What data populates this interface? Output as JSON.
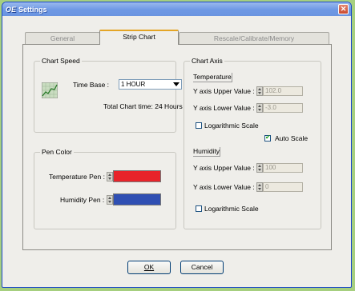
{
  "window": {
    "title": "Settings",
    "app_logo": "OE"
  },
  "tabs": [
    "General",
    "Strip Chart",
    "Rescale/Calibrate/Memory"
  ],
  "chart_speed": {
    "label": "Chart Speed",
    "time_base_label": "Time Base :",
    "time_base_value": "1 HOUR",
    "total_time": "Total Chart time: 24 Hours"
  },
  "pen_color": {
    "label": "Pen Color",
    "temperature_label": "Temperature Pen :",
    "humidity_label": "Humidity Pen :",
    "temperature_color": "#e8242a",
    "humidity_color": "#2f4fb3"
  },
  "chart_axis": {
    "label": "Chart Axis",
    "temperature": {
      "section": "Temperature",
      "upper_label": "Y axis Upper Value :",
      "upper_value": "102.0",
      "lower_label": "Y axis Lower Value :",
      "lower_value": "-3.0",
      "log_label": "Logarithmic Scale",
      "auto_label": "Auto Scale"
    },
    "humidity": {
      "section": "Humidity",
      "upper_label": "Y axis Upper Value :",
      "upper_value": "100",
      "lower_label": "Y axis Lower Value :",
      "lower_value": "0",
      "log_label": "Logarithmic Scale"
    }
  },
  "buttons": {
    "ok": "OK",
    "cancel": "Cancel"
  },
  "colors": {
    "accent_tab": "#e4a526",
    "titlebar": "#6e98e4",
    "background": "#a6cf7f"
  }
}
